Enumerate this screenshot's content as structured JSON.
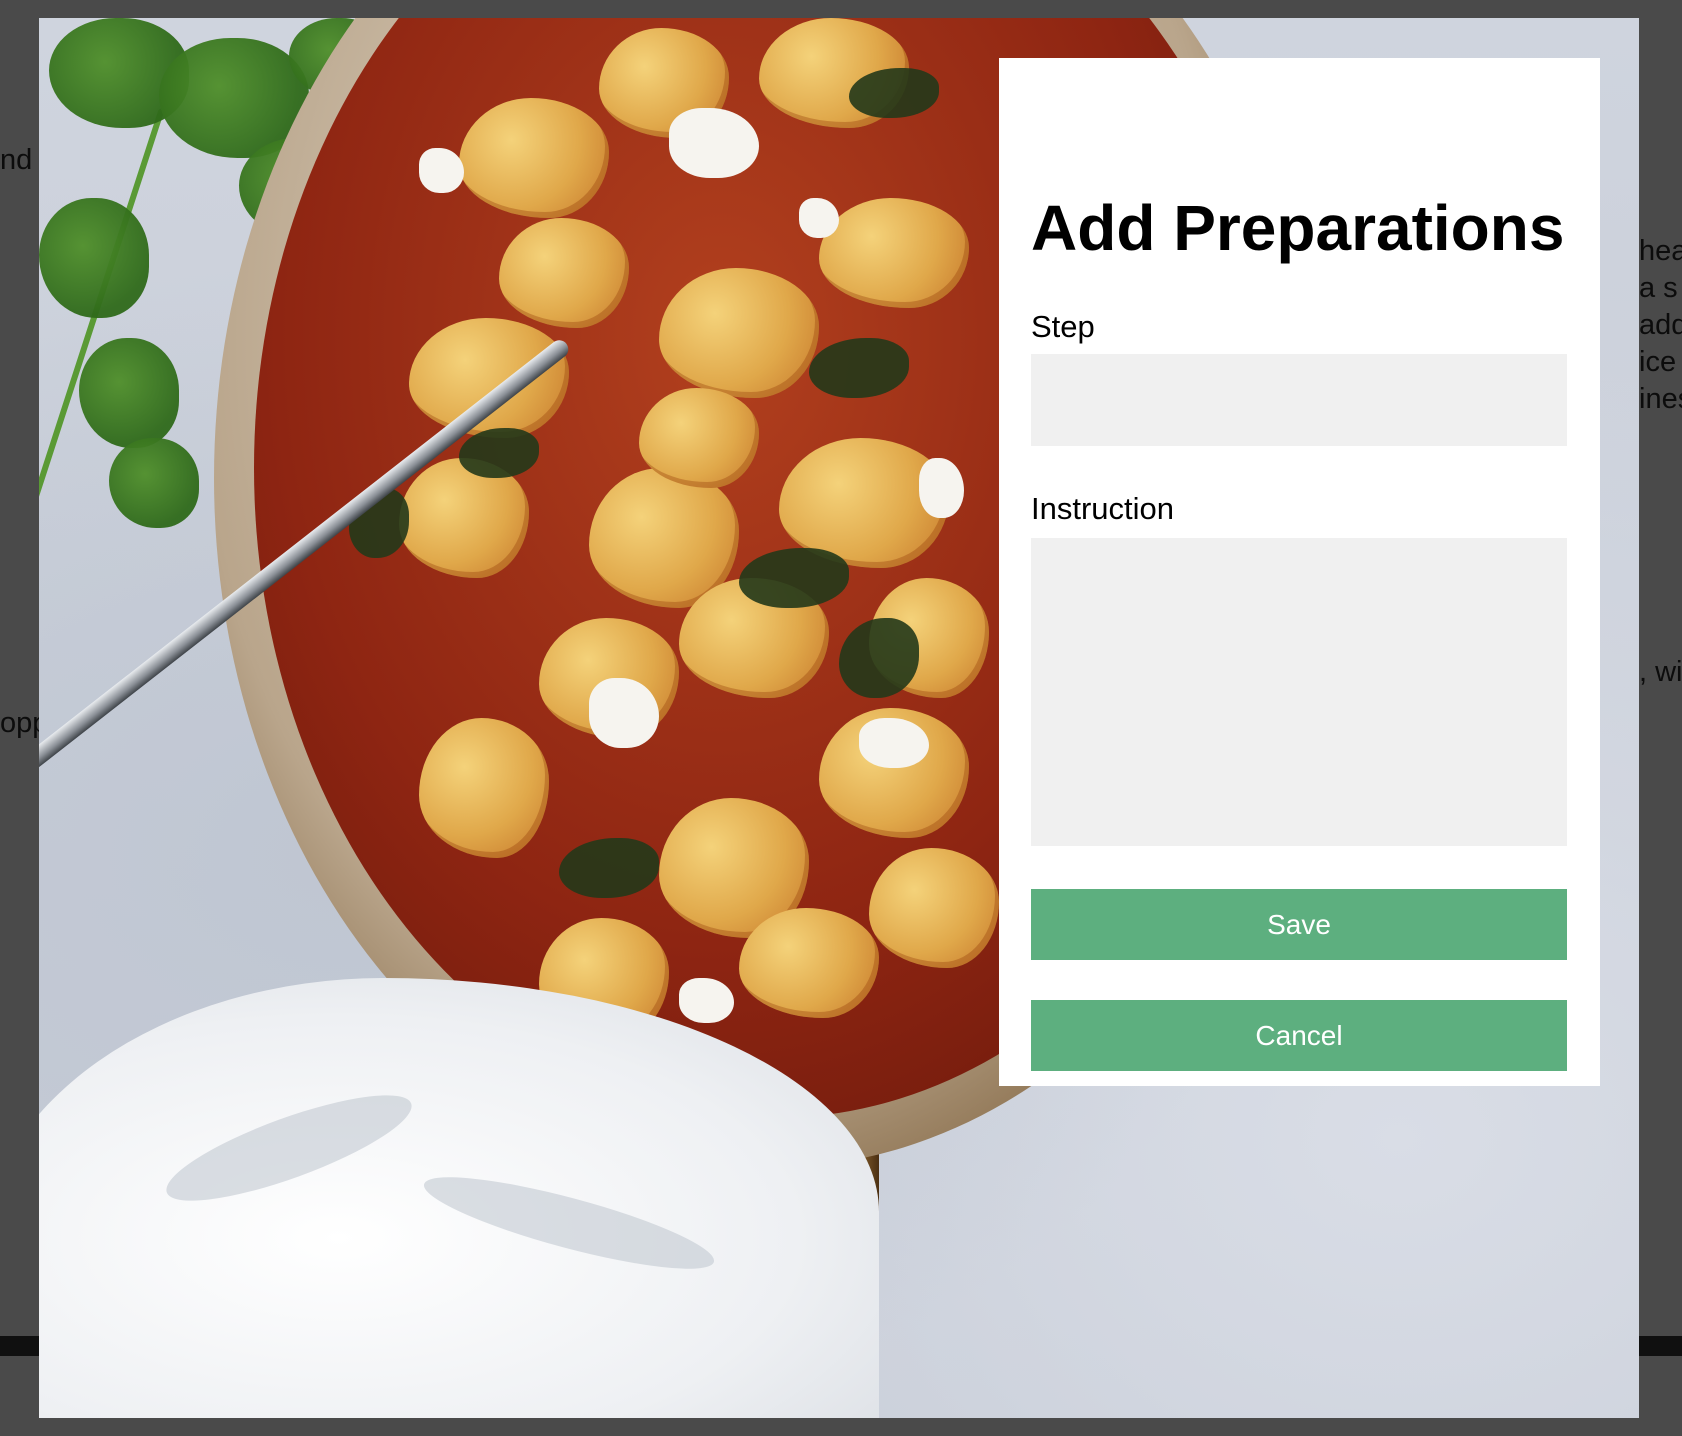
{
  "background_page": {
    "left_fragments": [
      "nd",
      "opp"
    ],
    "right_fragments": [
      "hea",
      "a s",
      "add",
      "ice",
      "ines"
    ],
    "right_fragment_lower": ", wi"
  },
  "modal": {
    "title": "Add Preparations",
    "step_label": "Step",
    "step_value": "",
    "instruction_label": "Instruction",
    "instruction_value": "",
    "save_label": "Save",
    "cancel_label": "Cancel"
  },
  "colors": {
    "overlay": "#474747",
    "modal_background": "#ffffff",
    "input_background": "#f0f0f0",
    "button_background": "#5daf7f",
    "button_text": "#ffffff"
  }
}
